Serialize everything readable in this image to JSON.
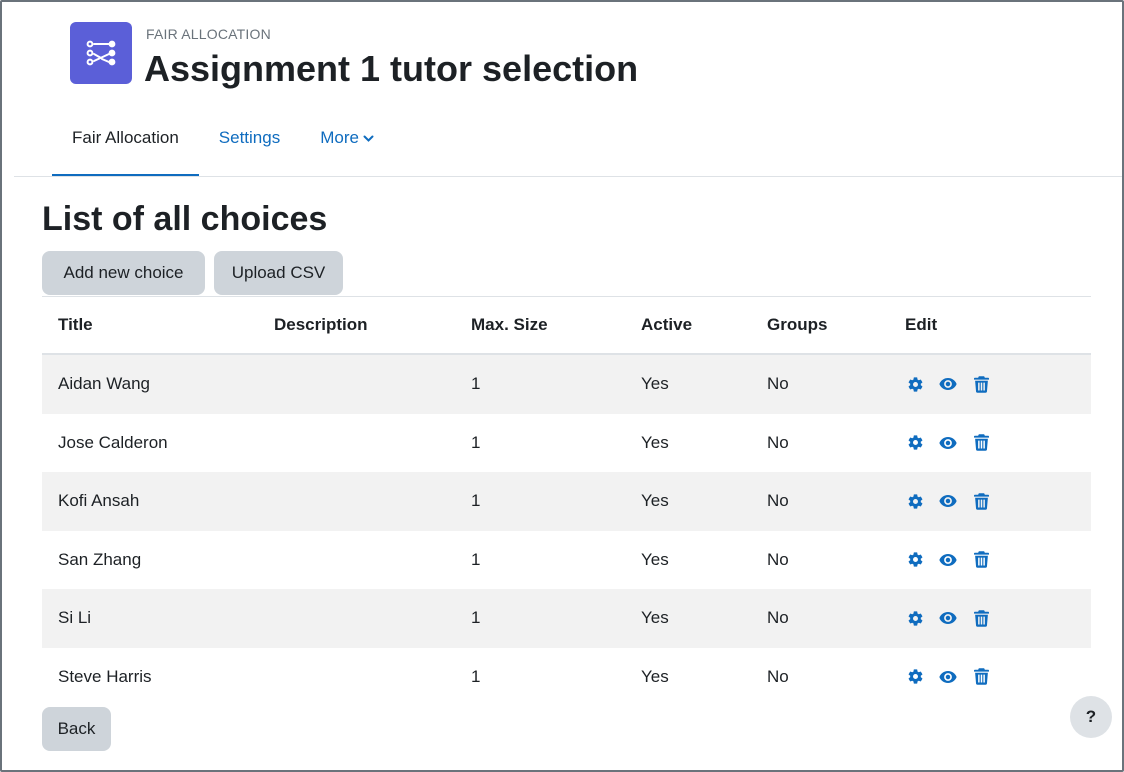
{
  "header": {
    "pretitle": "FAIR ALLOCATION",
    "title": "Assignment 1 tutor selection",
    "icon": "fair-allocation-icon"
  },
  "nav": {
    "tabs": [
      {
        "label": "Fair Allocation",
        "active": true
      },
      {
        "label": "Settings",
        "active": false
      },
      {
        "label": "More",
        "active": false
      }
    ]
  },
  "main": {
    "heading": "List of all choices",
    "add_button": "Add new choice",
    "upload_button": "Upload CSV",
    "back_button": "Back"
  },
  "table": {
    "columns": [
      "Title",
      "Description",
      "Max. Size",
      "Active",
      "Groups",
      "Edit"
    ],
    "rows": [
      {
        "title": "Aidan Wang",
        "description": "",
        "max_size": "1",
        "active": "Yes",
        "groups": "No"
      },
      {
        "title": "Jose Calderon",
        "description": "",
        "max_size": "1",
        "active": "Yes",
        "groups": "No"
      },
      {
        "title": "Kofi Ansah",
        "description": "",
        "max_size": "1",
        "active": "Yes",
        "groups": "No"
      },
      {
        "title": "San Zhang",
        "description": "",
        "max_size": "1",
        "active": "Yes",
        "groups": "No"
      },
      {
        "title": "Si Li",
        "description": "",
        "max_size": "1",
        "active": "Yes",
        "groups": "No"
      },
      {
        "title": "Steve Harris",
        "description": "",
        "max_size": "1",
        "active": "Yes",
        "groups": "No"
      }
    ],
    "row_actions": [
      "gear-icon",
      "eye-icon",
      "trash-icon"
    ]
  },
  "help": {
    "label": "?"
  },
  "colors": {
    "accent": "#0f6cbf",
    "module_icon_bg": "#5b5fd8",
    "button_bg": "#ced4da",
    "stripe_bg": "#f2f2f2"
  }
}
